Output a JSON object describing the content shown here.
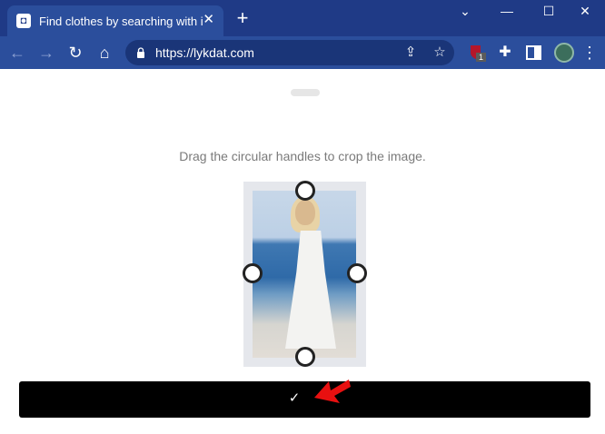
{
  "tab": {
    "title": "Find clothes by searching with im",
    "close": "✕"
  },
  "new_tab": "+",
  "window": {
    "minimize": "—",
    "maximize": "☐",
    "close": "✕",
    "tab_search": "⌄"
  },
  "omnibox": {
    "url": "https://lykdat.com"
  },
  "extensions": {
    "ublock_badge": "1"
  },
  "page": {
    "instruction": "Drag the circular handles to crop the image.",
    "confirm_symbol": "✓"
  },
  "colors": {
    "titlebar": "#1f3a86",
    "toolbar": "#2b4e9c",
    "confirm_bar": "#000000",
    "arrow": "#e81010"
  }
}
